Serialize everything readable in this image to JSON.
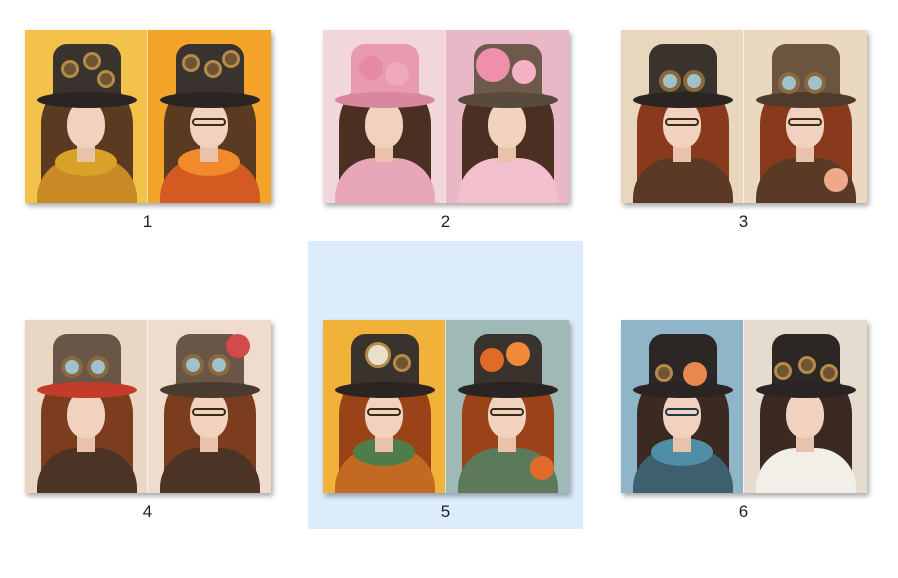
{
  "gallery": {
    "items": [
      {
        "label": "1",
        "selected": false,
        "left_bg": "#f2c24a",
        "right_bg": "#f5a42a",
        "hair": "#5b3a22",
        "body": "#c98a25",
        "accent": "#d7a227"
      },
      {
        "label": "2",
        "selected": false,
        "left_bg": "#f1d6dc",
        "right_bg": "#e9b8c6",
        "hair": "#4a2f22",
        "body": "#e8a7b8",
        "accent": "#e88aa6"
      },
      {
        "label": "3",
        "selected": false,
        "left_bg": "#e8d6bd",
        "right_bg": "#ead9c0",
        "hair": "#8a3a1c",
        "body": "#5a3a24",
        "accent": "#f0a78a"
      },
      {
        "label": "4",
        "selected": false,
        "left_bg": "#ead7c3",
        "right_bg": "#f0dccf",
        "hair": "#7b3d1e",
        "body": "#4b3325",
        "accent": "#c23b2b"
      },
      {
        "label": "5",
        "selected": true,
        "left_bg": "#f0b238",
        "right_bg": "#9fb9b7",
        "hair": "#9a4318",
        "body": "#c26a22",
        "accent": "#e06a2a"
      },
      {
        "label": "6",
        "selected": false,
        "left_bg": "#8fb5c9",
        "right_bg": "#e5dccf",
        "hair": "#3a2a22",
        "body": "#3d5f6e",
        "accent": "#e8874f"
      }
    ]
  }
}
